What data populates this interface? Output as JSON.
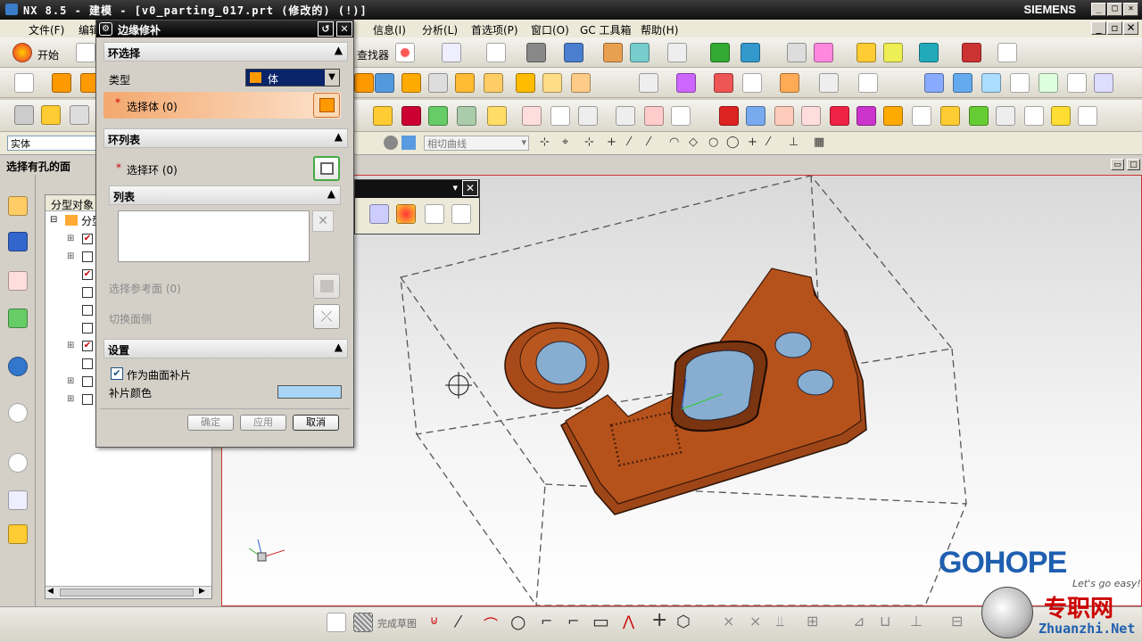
{
  "window": {
    "title": "NX 8.5 - 建模 - [v0_parting_017.prt (修改的)    (!)]",
    "brand": "SIEMENS"
  },
  "menu": [
    "文件(F)",
    "编辑",
    "信息(I)",
    "分析(L)",
    "首选项(P)",
    "窗口(O)",
    "GC 工具箱",
    "帮助(H)"
  ],
  "toolbar": {
    "start_label": "开始",
    "find_label": "查找器",
    "curve_filter": "相切曲线"
  },
  "selection": {
    "filter": "实体",
    "prompt": "选择有孔的面"
  },
  "navigator": {
    "column": "分型对象",
    "root": "分型",
    "checks": [
      true,
      false,
      true,
      false,
      false,
      false,
      true,
      false,
      false,
      false
    ]
  },
  "dialog": {
    "title": "边缘修补",
    "sec_loop_select": "环选择",
    "type_label": "类型",
    "type_value": "体",
    "select_body": "选择体 (0)",
    "sec_loop_list": "环列表",
    "select_loop": "选择环 (0)",
    "sec_list": "列表",
    "select_ref_face": "选择参考面 (0)",
    "switch_side": "切换面侧",
    "sec_settings": "设置",
    "as_patch_label": "作为曲面补片",
    "as_patch_checked": true,
    "patch_color_label": "补片颜色",
    "patch_color": "#a8d4f5",
    "ok": "确定",
    "apply": "应用",
    "cancel": "取消"
  },
  "bottom": {
    "finish_sketch": "完成草图"
  },
  "watermark": {
    "brand": "GOHOPE",
    "tagline": "Let's go easy!",
    "site_cn": "专职网",
    "site": "Zhuanzhi.Net"
  },
  "colors": {
    "part": "#b5521c",
    "glass": "#87aed0"
  }
}
